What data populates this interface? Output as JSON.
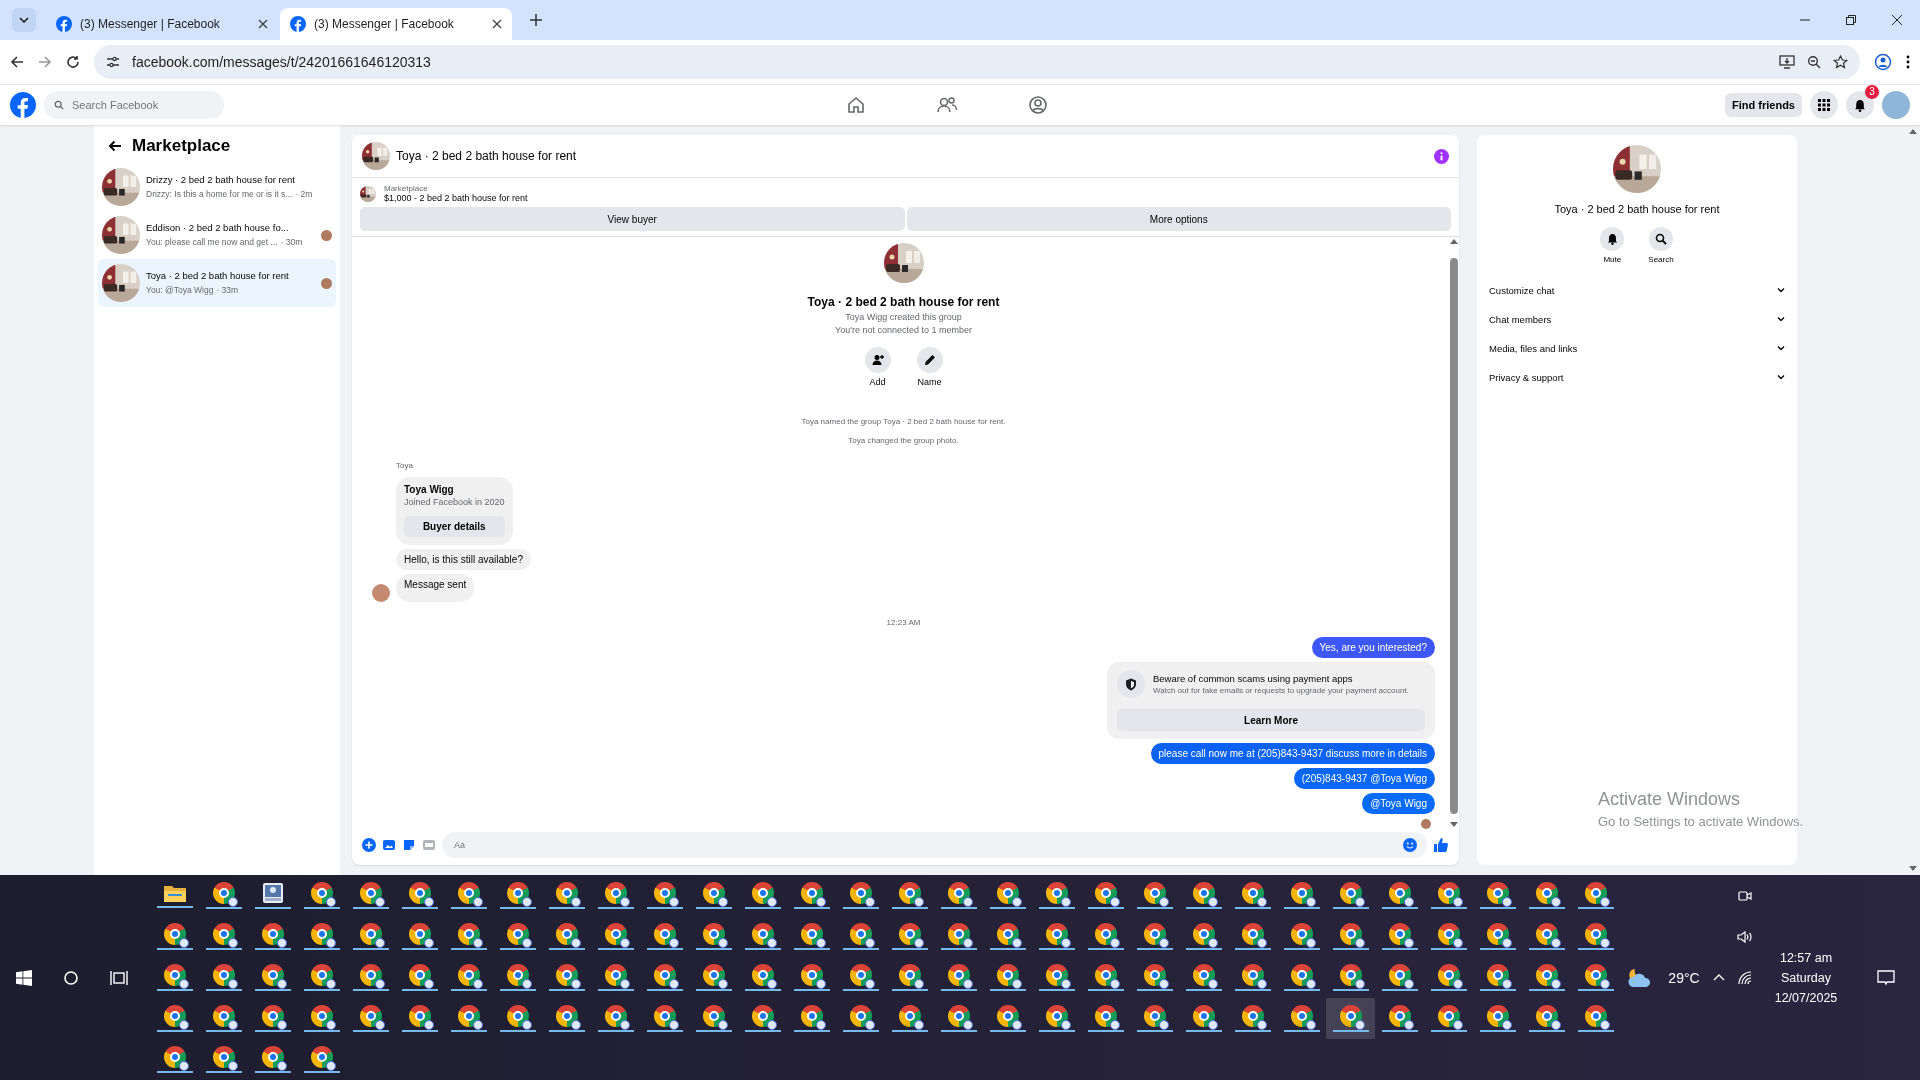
{
  "browser": {
    "tabs": [
      {
        "title": "(3) Messenger | Facebook",
        "selected": false
      },
      {
        "title": "(3) Messenger | Facebook",
        "selected": true
      }
    ],
    "url": "facebook.com/messages/t/24201661646120313"
  },
  "facebook_header": {
    "search": {
      "placeholder": "Search Facebook"
    },
    "nav": [
      {
        "kind": "home"
      },
      {
        "kind": "friends"
      },
      {
        "kind": "groups"
      }
    ],
    "find_friends": "Find friends",
    "notification_count": "3"
  },
  "sidebar": {
    "title": "Marketplace",
    "conversations": [
      {
        "title": "Drizzy · 2 bed 2 bath house for rent",
        "preview": "Drizzy: Is this a home for me or is it s...",
        "time": "· 2m",
        "selected": false,
        "seen": false
      },
      {
        "title": "Eddison · 2 bed 2 bath house fo...",
        "preview": "You: please call me now and get ...",
        "time": "· 30m",
        "selected": false,
        "seen": true
      },
      {
        "title": "Toya · 2 bed 2 bath house for rent",
        "preview": "You: @Toya Wigg",
        "time": "· 33m",
        "selected": true,
        "seen": true
      }
    ]
  },
  "chat": {
    "title": "Toya · 2 bed 2 bath house for rent",
    "listing": {
      "label": "Marketplace",
      "title": "$1,000 - 2 bed 2 bath house for rent",
      "buttons": [
        "View buyer",
        "More options"
      ]
    },
    "intro": {
      "title": "Toya · 2 bed 2 bath house for rent",
      "lines": [
        "Toya Wigg created this group",
        "You're not connected to 1 member"
      ],
      "actions": [
        {
          "kind": "add",
          "label": "Add"
        },
        {
          "kind": "name",
          "label": "Name"
        }
      ],
      "notes": [
        "Toya named the group Toya · 2 bed 2 bath house for rent.",
        "Toya changed the group photo."
      ]
    },
    "messages": [
      {
        "kind": "sender",
        "text": "Toya"
      },
      {
        "kind": "profile",
        "name": "Toya Wigg",
        "detail": "Joined Facebook in 2020",
        "button": "Buyer details"
      },
      {
        "kind": "incoming",
        "text": "Hello, is this still available?",
        "avatar": false
      },
      {
        "kind": "incoming",
        "text": "Message sent",
        "avatar": true
      },
      {
        "kind": "timestamp",
        "text": "12:23 AM"
      },
      {
        "kind": "outgoing",
        "text": "Yes, are you interested?",
        "color": "#3e57f8",
        "seen": false
      },
      {
        "kind": "notice",
        "title": "Beware of common scams using payment apps",
        "text": "Watch out for fake emails or requests to upgrade your payment account.",
        "button": "Learn More"
      },
      {
        "kind": "outgoing",
        "text": "please call now me at (205)843-9437 discuss more in details",
        "color": "#0b62f4",
        "seen": false
      },
      {
        "kind": "outgoing",
        "text": "(205)843-9437 @Toya Wigg",
        "color": "#0a66f6",
        "seen": false
      },
      {
        "kind": "outgoing",
        "text": "@Toya Wigg",
        "color": "#086bf8",
        "seen": true
      }
    ],
    "composer": {
      "placeholder": "Aa"
    }
  },
  "details": {
    "title": "Toya · 2 bed 2 bath house for rent",
    "actions": [
      {
        "kind": "mute",
        "label": "Mute"
      },
      {
        "kind": "search",
        "label": "Search"
      }
    ],
    "sections": [
      {
        "label": "Customize chat",
        "expanded": false
      },
      {
        "label": "Chat members",
        "expanded": false
      },
      {
        "label": "Media, files and links",
        "expanded": false
      },
      {
        "label": "Privacy & support",
        "expanded": false
      }
    ]
  },
  "activation_notice": {
    "title": "Activate Windows",
    "text": "Go to Settings to activate Windows."
  },
  "taskbar": {
    "apps": [
      {
        "kind": "folder",
        "selected": false
      },
      {
        "kind": "chrome",
        "selected": false
      },
      {
        "kind": "contacts",
        "selected": false
      },
      {
        "kind": "chrome",
        "selected": false
      },
      {
        "kind": "chrome",
        "selected": false
      },
      {
        "kind": "chrome",
        "selected": false
      },
      {
        "kind": "chrome",
        "selected": false
      },
      {
        "kind": "chrome",
        "selected": false
      },
      {
        "kind": "chrome",
        "selected": false
      },
      {
        "kind": "chrome",
        "selected": false
      },
      {
        "kind": "chrome",
        "selected": false
      },
      {
        "kind": "chrome",
        "selected": false
      },
      {
        "kind": "chrome",
        "selected": false
      },
      {
        "kind": "chrome",
        "selected": false
      },
      {
        "kind": "chrome",
        "selected": false
      },
      {
        "kind": "chrome",
        "selected": false
      },
      {
        "kind": "chrome",
        "selected": false
      },
      {
        "kind": "chrome",
        "selected": false
      },
      {
        "kind": "chrome",
        "selected": false
      },
      {
        "kind": "chrome",
        "selected": false
      },
      {
        "kind": "chrome",
        "selected": false
      },
      {
        "kind": "chrome",
        "selected": false
      },
      {
        "kind": "chrome",
        "selected": false
      },
      {
        "kind": "chrome",
        "selected": false
      },
      {
        "kind": "chrome",
        "selected": false
      },
      {
        "kind": "chrome",
        "selected": false
      },
      {
        "kind": "chrome",
        "selected": false
      },
      {
        "kind": "chrome",
        "selected": false
      },
      {
        "kind": "chrome",
        "selected": false
      },
      {
        "kind": "chrome",
        "selected": false
      },
      {
        "kind": "chrome",
        "selected": false
      },
      {
        "kind": "chrome",
        "selected": false
      },
      {
        "kind": "chrome",
        "selected": false
      },
      {
        "kind": "chrome",
        "selected": false
      },
      {
        "kind": "chrome",
        "selected": false
      },
      {
        "kind": "chrome",
        "selected": false
      },
      {
        "kind": "chrome",
        "selected": false
      },
      {
        "kind": "chrome",
        "selected": false
      },
      {
        "kind": "chrome",
        "selected": false
      },
      {
        "kind": "chrome",
        "selected": false
      },
      {
        "kind": "chrome",
        "selected": false
      },
      {
        "kind": "chrome",
        "selected": false
      },
      {
        "kind": "chrome",
        "selected": false
      },
      {
        "kind": "chrome",
        "selected": false
      },
      {
        "kind": "chrome",
        "selected": false
      },
      {
        "kind": "chrome",
        "selected": false
      },
      {
        "kind": "chrome",
        "selected": false
      },
      {
        "kind": "chrome",
        "selected": false
      },
      {
        "kind": "chrome",
        "selected": false
      },
      {
        "kind": "chrome",
        "selected": false
      },
      {
        "kind": "chrome",
        "selected": false
      },
      {
        "kind": "chrome",
        "selected": false
      },
      {
        "kind": "chrome",
        "selected": false
      },
      {
        "kind": "chrome",
        "selected": false
      },
      {
        "kind": "chrome",
        "selected": false
      },
      {
        "kind": "chrome",
        "selected": false
      },
      {
        "kind": "chrome",
        "selected": false
      },
      {
        "kind": "chrome",
        "selected": false
      },
      {
        "kind": "chrome",
        "selected": false
      },
      {
        "kind": "chrome",
        "selected": false
      },
      {
        "kind": "chrome",
        "selected": false
      },
      {
        "kind": "chrome",
        "selected": false
      },
      {
        "kind": "chrome",
        "selected": false
      },
      {
        "kind": "chrome",
        "selected": false
      },
      {
        "kind": "chrome",
        "selected": false
      },
      {
        "kind": "chrome",
        "selected": false
      },
      {
        "kind": "chrome",
        "selected": false
      },
      {
        "kind": "chrome",
        "selected": false
      },
      {
        "kind": "chrome",
        "selected": false
      },
      {
        "kind": "chrome",
        "selected": false
      },
      {
        "kind": "chrome",
        "selected": false
      },
      {
        "kind": "chrome",
        "selected": false
      },
      {
        "kind": "chrome",
        "selected": false
      },
      {
        "kind": "chrome",
        "selected": false
      },
      {
        "kind": "chrome",
        "selected": false
      },
      {
        "kind": "chrome",
        "selected": false
      },
      {
        "kind": "chrome",
        "selected": false
      },
      {
        "kind": "chrome",
        "selected": false
      },
      {
        "kind": "chrome",
        "selected": false
      },
      {
        "kind": "chrome",
        "selected": false
      },
      {
        "kind": "chrome",
        "selected": false
      },
      {
        "kind": "chrome",
        "selected": false
      },
      {
        "kind": "chrome",
        "selected": false
      },
      {
        "kind": "chrome",
        "selected": false
      },
      {
        "kind": "chrome",
        "selected": false
      },
      {
        "kind": "chrome",
        "selected": false
      },
      {
        "kind": "chrome",
        "selected": false
      },
      {
        "kind": "chrome",
        "selected": false
      },
      {
        "kind": "chrome",
        "selected": false
      },
      {
        "kind": "chrome",
        "selected": false
      },
      {
        "kind": "chrome",
        "selected": false
      },
      {
        "kind": "chrome",
        "selected": false
      },
      {
        "kind": "chrome",
        "selected": false
      },
      {
        "kind": "chrome",
        "selected": false
      },
      {
        "kind": "chrome",
        "selected": false
      },
      {
        "kind": "chrome",
        "selected": false
      },
      {
        "kind": "chrome",
        "selected": false
      },
      {
        "kind": "chrome",
        "selected": false
      },
      {
        "kind": "chrome",
        "selected": false
      },
      {
        "kind": "chrome",
        "selected": false
      },
      {
        "kind": "chrome",
        "selected": false
      },
      {
        "kind": "chrome",
        "selected": false
      },
      {
        "kind": "chrome",
        "selected": false
      },
      {
        "kind": "chrome",
        "selected": false
      },
      {
        "kind": "chrome",
        "selected": false
      },
      {
        "kind": "chrome",
        "selected": false
      },
      {
        "kind": "chrome",
        "selected": false
      },
      {
        "kind": "chrome",
        "selected": false
      },
      {
        "kind": "chrome",
        "selected": false
      },
      {
        "kind": "chrome",
        "selected": false
      },
      {
        "kind": "chrome",
        "selected": false
      },
      {
        "kind": "chrome",
        "selected": false
      },
      {
        "kind": "chrome",
        "selected": false
      },
      {
        "kind": "chrome",
        "selected": false
      },
      {
        "kind": "chrome",
        "selected": true
      },
      {
        "kind": "chrome",
        "selected": false
      },
      {
        "kind": "chrome",
        "selected": false
      },
      {
        "kind": "chrome",
        "selected": false
      },
      {
        "kind": "chrome",
        "selected": false
      },
      {
        "kind": "chrome",
        "selected": false
      },
      {
        "kind": "chrome",
        "selected": false
      },
      {
        "kind": "chrome",
        "selected": false
      },
      {
        "kind": "chrome",
        "selected": false
      },
      {
        "kind": "chrome",
        "selected": false
      }
    ],
    "tray": {
      "temperature": "29°C",
      "time": "12:57 am",
      "day": "Saturday",
      "date": "12/07/2025"
    }
  }
}
